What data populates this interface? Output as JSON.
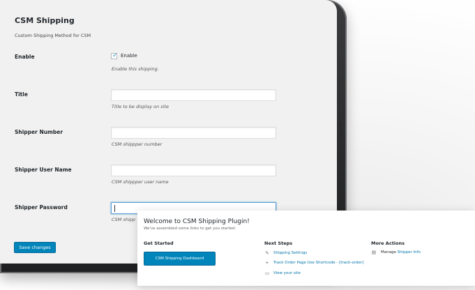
{
  "settings": {
    "title": "CSM Shipping",
    "description": "Custom Shipping Method for CSM",
    "enable": {
      "label": "Enable",
      "checkbox_label": "Enable",
      "checked": true,
      "help": "Enable this shipping."
    },
    "title_field": {
      "label": "Title",
      "value": "",
      "help": "Title to be display on site"
    },
    "shipper_number": {
      "label": "Shipper Number",
      "value": "",
      "help": "CSM shippper number"
    },
    "shipper_user_name": {
      "label": "Shipper User Name",
      "value": "",
      "help": "CSM shippper user name"
    },
    "shipper_password": {
      "label": "Shipper Password",
      "value": "",
      "help_visible": "CSM shipp"
    },
    "save_label": "Save changes"
  },
  "welcome": {
    "title": "Welcome to CSM Shipping Plugin!",
    "subtitle": "We've assembled some links to get you started:",
    "get_started": {
      "heading": "Get Started",
      "button_label": "CSM Shipping Dashboard"
    },
    "next_steps": {
      "heading": "Next Steps",
      "items": [
        {
          "icon": "edit-icon",
          "label": "Shipping Settings"
        },
        {
          "icon": "plus-icon",
          "label": "Track Order Page Use Shortcode - [track-order]"
        },
        {
          "icon": "monitor-icon",
          "label": "View your site"
        }
      ]
    },
    "more_actions": {
      "heading": "More Actions",
      "items": [
        {
          "icon": "dashboard-icon",
          "prefix": "Manage ",
          "link": "Shipper Info"
        }
      ]
    }
  },
  "colors": {
    "accent": "#0085ba",
    "link": "#0073aa",
    "screen_bg": "#f1f1f1",
    "device": "#2b2c2e"
  }
}
